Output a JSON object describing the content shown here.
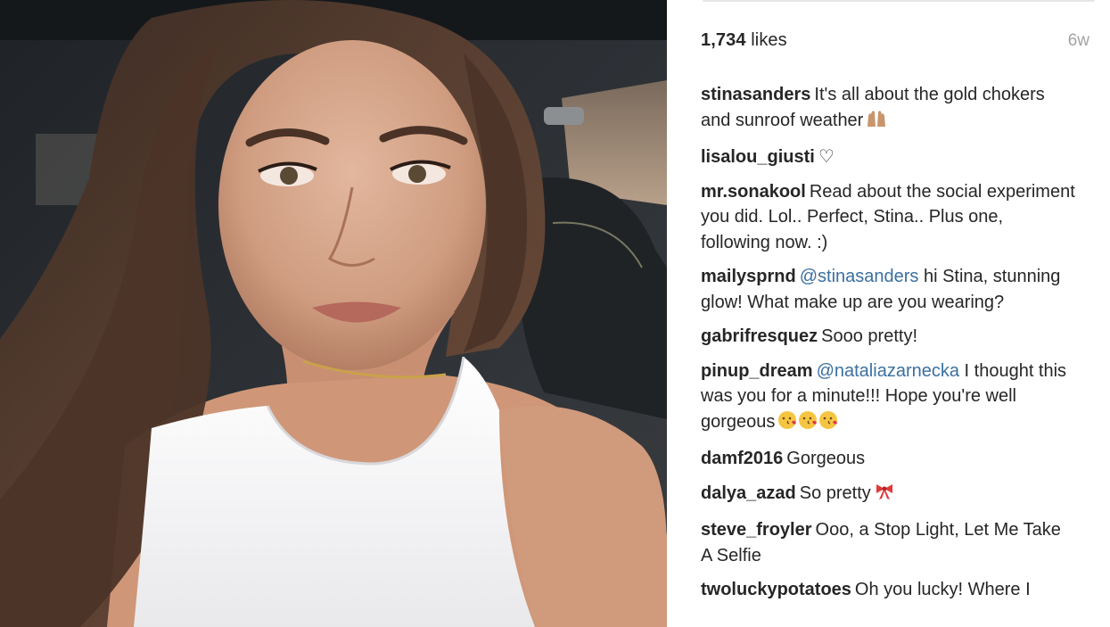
{
  "post": {
    "likes_count": "1,734",
    "likes_word": "likes",
    "age": "6w"
  },
  "comments": [
    {
      "user": "stinasanders",
      "mention": "",
      "text": "It's all about the gold chokers and sunroof weather",
      "emoji": "raised-hands"
    },
    {
      "user": "lisalou_giusti",
      "mention": "",
      "text": "♡",
      "emoji": ""
    },
    {
      "user": "mr.sonakool",
      "mention": "",
      "text": "Read about the social experiment you did. Lol.. Perfect, Stina.. Plus one, following now. :)",
      "emoji": ""
    },
    {
      "user": "mailysprnd",
      "mention": "@stinasanders",
      "text": "hi Stina, stunning glow! What make up are you wearing?",
      "emoji": ""
    },
    {
      "user": "gabrifresquez",
      "mention": "",
      "text": "Sooo pretty!",
      "emoji": ""
    },
    {
      "user": "pinup_dream",
      "mention": "@nataliazarnecka",
      "text": "I thought this was you for a minute!!! Hope you're well gorgeous",
      "emoji": "kissing-face x3"
    },
    {
      "user": "damf2016",
      "mention": "",
      "text": "Gorgeous",
      "emoji": ""
    },
    {
      "user": "dalya_azad",
      "mention": "",
      "text": "So pretty",
      "emoji": "ribbon"
    },
    {
      "user": "steve_froyler",
      "mention": "",
      "text": "Ooo, a Stop Light, Let Me Take A Selfie",
      "emoji": ""
    },
    {
      "user": "twoluckypotatoes",
      "mention": "",
      "text": "Oh you lucky! Where I",
      "emoji": ""
    }
  ],
  "colors": {
    "username": "#262626",
    "mention": "#3b6fa0",
    "meta": "#a3a3a3"
  }
}
